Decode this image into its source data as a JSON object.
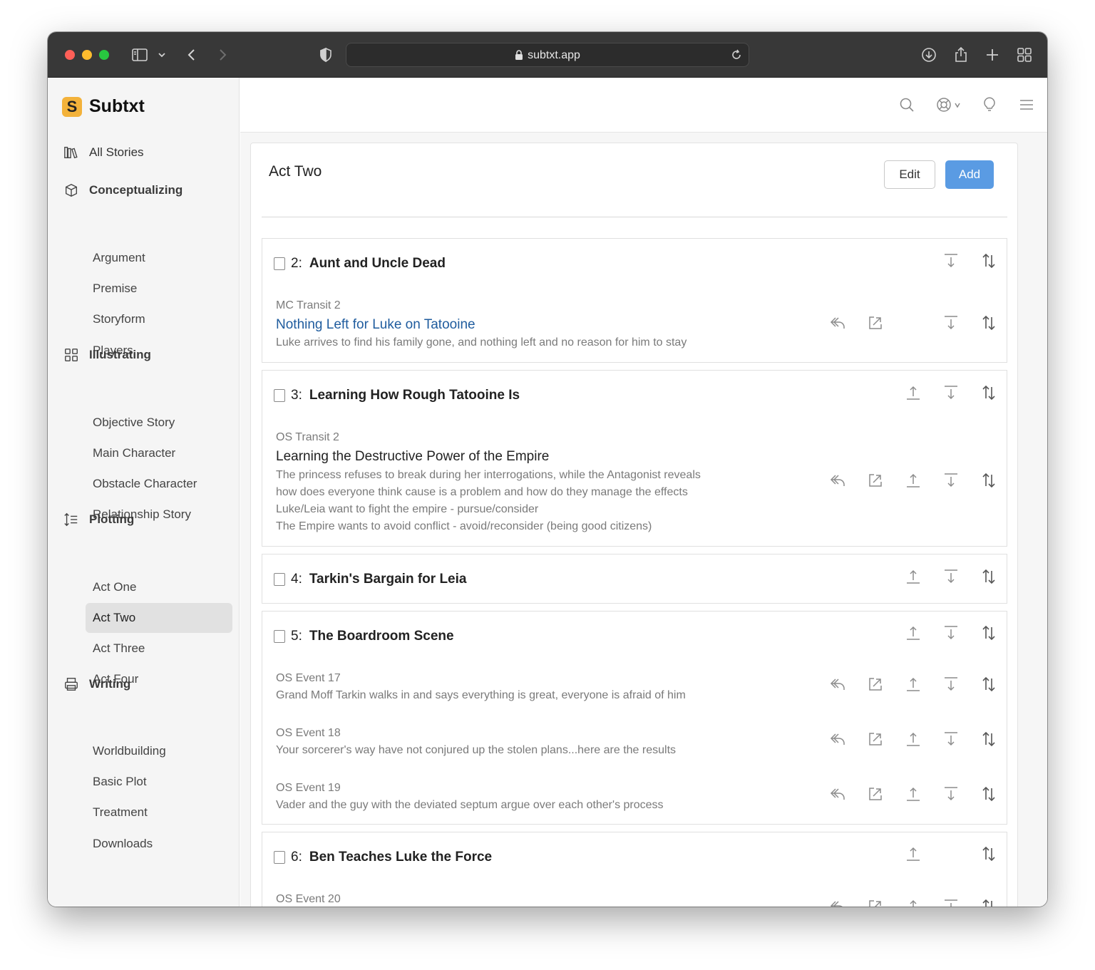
{
  "browser": {
    "url": "subtxt.app",
    "lock_icon": "lock-icon"
  },
  "sidebar": {
    "logo_letter": "S",
    "logo_text": "Subtxt",
    "all_stories": "All Stories",
    "sections": [
      {
        "label": "Conceptualizing",
        "items": [
          "Argument",
          "Premise",
          "Storyform",
          "Players"
        ]
      },
      {
        "label": "Illustrating",
        "items": [
          "Objective Story",
          "Main Character",
          "Obstacle Character",
          "Relationship Story"
        ]
      },
      {
        "label": "Plotting",
        "items": [
          "Act One",
          "Act Two",
          "Act Three",
          "Act Four"
        ]
      },
      {
        "label": "Writing",
        "items": [
          "Worldbuilding",
          "Basic Plot",
          "Treatment",
          "Downloads"
        ]
      }
    ],
    "active_item": "Act Two"
  },
  "panel": {
    "title": "Act Two",
    "edit_label": "Edit",
    "add_label": "Add"
  },
  "cards": [
    {
      "num": "2:",
      "title": "Aunt and Uncle Dead",
      "events": [
        {
          "type": "MC Transit 2",
          "title": "Nothing Left for Luke on Tatooine",
          "desc": [
            "Luke arrives to find his family gone, and nothing left and no reason for him to stay"
          ]
        }
      ]
    },
    {
      "num": "3:",
      "title": "Learning How Rough Tatooine Is",
      "events": [
        {
          "type": "OS Transit 2",
          "title": "Learning the Destructive Power of the Empire",
          "desc": [
            "The princess refuses to break during her interrogations, while the Antagonist reveals",
            "how does everyone think cause is a problem and how do they manage the effects",
            "Luke/Leia want to fight the empire - pursue/consider",
            "The Empire wants to avoid conflict - avoid/reconsider (being good citizens)"
          ]
        }
      ]
    },
    {
      "num": "4:",
      "title": "Tarkin's Bargain for Leia",
      "events": []
    },
    {
      "num": "5:",
      "title": "The Boardroom Scene",
      "events": [
        {
          "type": "OS Event 17",
          "desc": [
            "Grand Moff Tarkin walks in and says everything is great, everyone is afraid of him"
          ]
        },
        {
          "type": "OS Event 18",
          "desc": [
            "Your sorcerer's way have not conjured up the stolen plans...here are the results"
          ]
        },
        {
          "type": "OS Event 19",
          "desc": [
            "Vader and the guy with the deviated septum argue over each other's process"
          ]
        }
      ]
    },
    {
      "num": "6:",
      "title": "Ben Teaches Luke the Force",
      "events": [
        {
          "type": "OS Event 20",
          "desc": []
        }
      ]
    }
  ]
}
